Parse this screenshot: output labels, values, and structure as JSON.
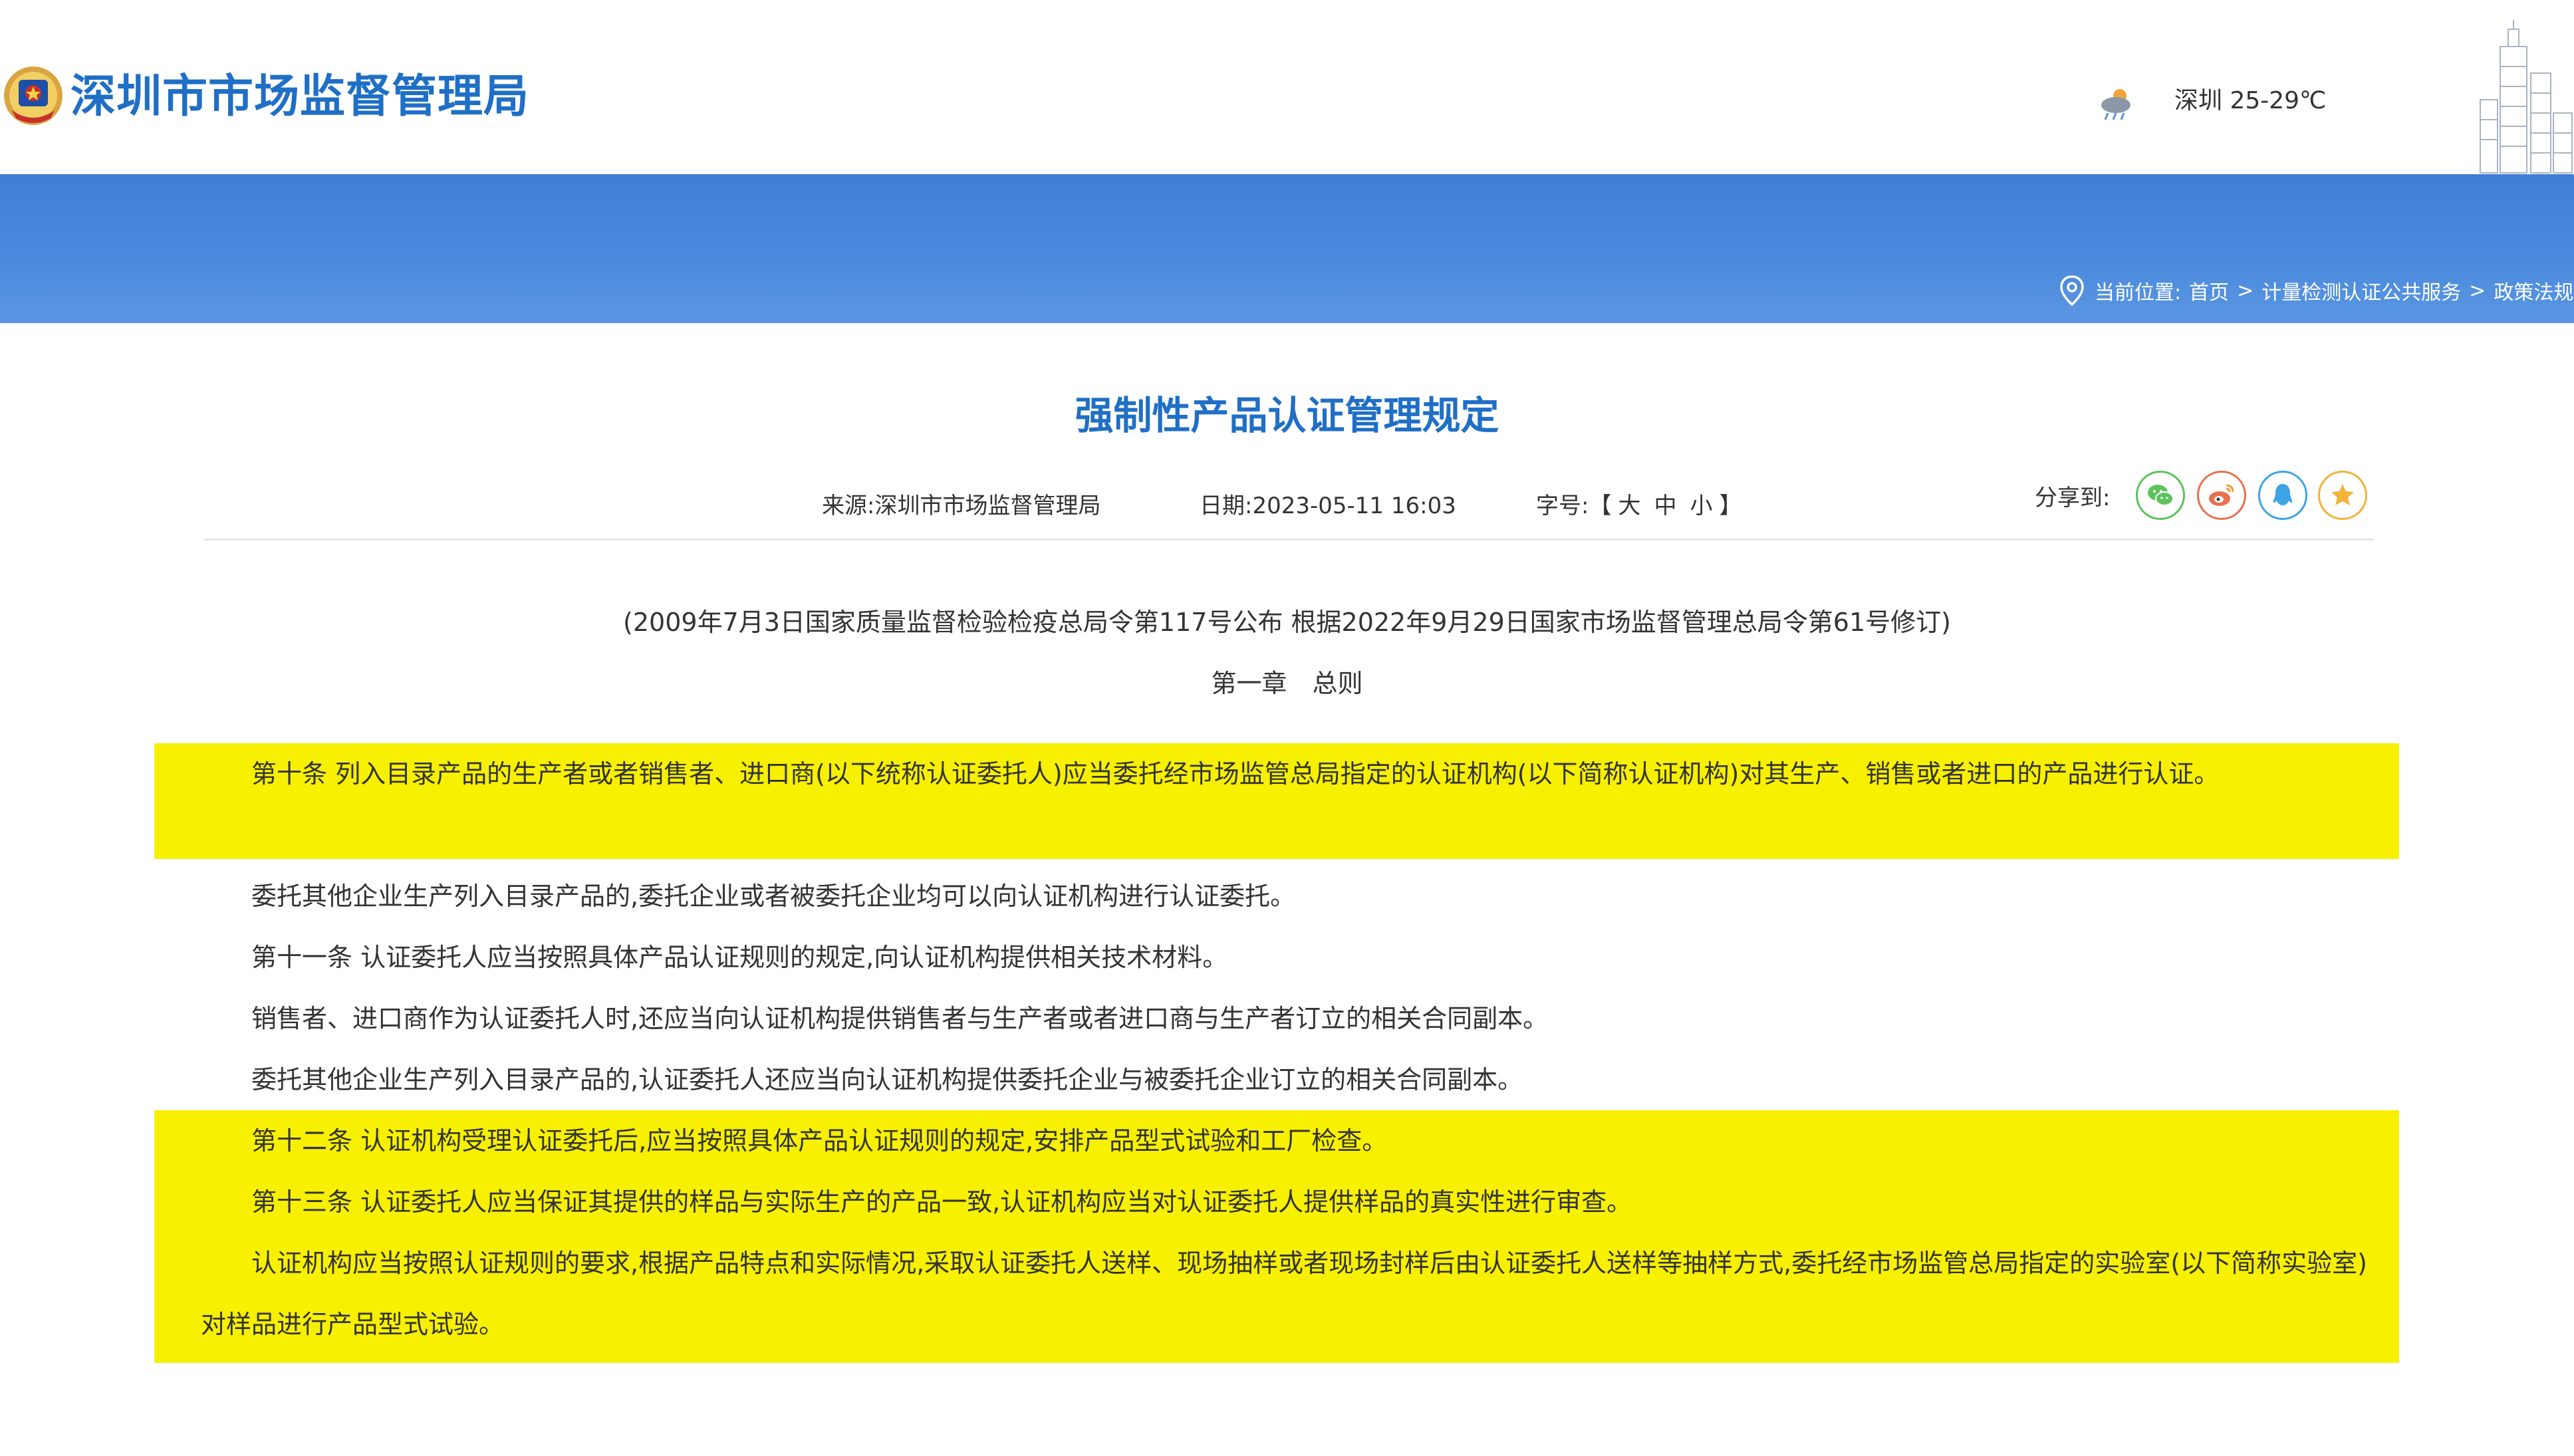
{
  "header": {
    "site_title": "深圳市市场监督管理局",
    "weather": "深圳 25-29℃"
  },
  "breadcrumb": {
    "label": "当前位置:",
    "items": [
      "首页",
      "计量检测认证公共服务",
      "政策法规"
    ],
    "separator": ">"
  },
  "article": {
    "title": "强制性产品认证管理规定",
    "source_label": "来源:",
    "source": "深圳市市场监督管理局",
    "date_label": "日期:",
    "date": "2023-05-11 16:03",
    "font_size_label": "字号:",
    "font_size_open": "【",
    "font_size_close": "】",
    "font_sizes": [
      "大",
      "中",
      "小"
    ],
    "share_label": "分享到:",
    "subtitle": "(2009年7月3日国家质量监督检验检疫总局令第117号公布 根据2022年9月29日国家市场监督管理总局令第61号修订)",
    "chapter": "第一章　总则",
    "paragraphs": [
      "第十条 列入目录产品的生产者或者销售者、进口商(以下统称认证委托人)应当委托经市场监管总局指定的认证机构(以下简称认证机构)对其生产、销售或者进口的产品进行认证。",
      "委托其他企业生产列入目录产品的,委托企业或者被委托企业均可以向认证机构进行认证委托。",
      "第十一条 认证委托人应当按照具体产品认证规则的规定,向认证机构提供相关技术材料。",
      "销售者、进口商作为认证委托人时,还应当向认证机构提供销售者与生产者或者进口商与生产者订立的相关合同副本。",
      "委托其他企业生产列入目录产品的,认证委托人还应当向认证机构提供委托企业与被委托企业订立的相关合同副本。",
      "第十二条 认证机构受理认证委托后,应当按照具体产品认证规则的规定,安排产品型式试验和工厂检查。",
      "第十三条 认证委托人应当保证其提供的样品与实际生产的产品一致,认证机构应当对认证委托人提供样品的真实性进行审查。",
      "认证机构应当按照认证规则的要求,根据产品特点和实际情况,采取认证委托人送样、现场抽样或者现场封样后由认证委托人送样等抽样方式,委托经市场监管总局指定的实验室(以下简称实验室)对样品进行产品型式试验。"
    ]
  },
  "colors": {
    "brand_blue": "#1f6fc6",
    "banner_blue": "#4a89dd",
    "highlight_yellow": "#f7f000"
  },
  "icons": [
    "emblem-logo",
    "weather-icon",
    "skyline-image",
    "location-pin-icon",
    "wechat-icon",
    "weibo-icon",
    "qq-icon",
    "favorite-star-icon"
  ]
}
